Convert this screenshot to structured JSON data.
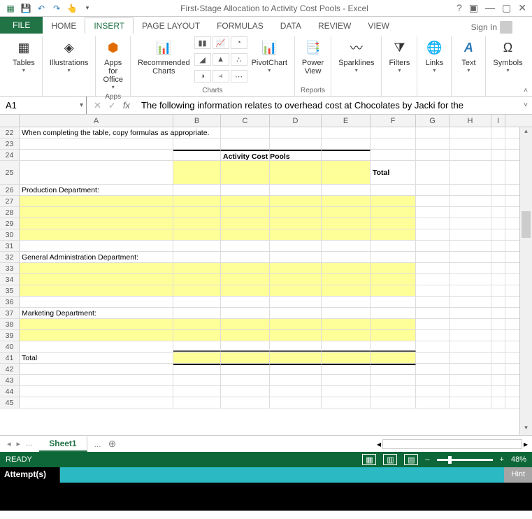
{
  "titlebar": {
    "title": "First-Stage Allocation to Activity Cost Pools - Excel"
  },
  "tabs": {
    "file": "FILE",
    "home": "HOME",
    "insert": "INSERT",
    "page_layout": "PAGE LAYOUT",
    "formulas": "FORMULAS",
    "data": "DATA",
    "review": "REVIEW",
    "view": "VIEW",
    "signin": "Sign In"
  },
  "ribbon": {
    "tables": "Tables",
    "illustrations": "Illustrations",
    "apps_for_office": "Apps for\nOffice",
    "apps": "Apps",
    "recommended_charts": "Recommended\nCharts",
    "charts": "Charts",
    "pivotchart": "PivotChart",
    "power_view": "Power\nView",
    "reports": "Reports",
    "sparklines": "Sparklines",
    "filters": "Filters",
    "links": "Links",
    "text": "Text",
    "symbols": "Symbols"
  },
  "formula_bar": {
    "cell_ref": "A1",
    "formula": "The following information relates to overhead cost at Chocolates by Jacki for the"
  },
  "columns": [
    "A",
    "B",
    "C",
    "D",
    "E",
    "F",
    "G",
    "H",
    "I"
  ],
  "rows": {
    "r22": "When completing the table, copy formulas as appropriate.",
    "r24_header": "Activity Cost Pools",
    "r25_total": "Total",
    "r26": "Production Department:",
    "r32": "General Administration Department:",
    "r37": "Marketing Department:",
    "r41": "Total"
  },
  "sheetbar": {
    "sheet1": "Sheet1",
    "dots1": "...",
    "dots2": "..."
  },
  "statusbar": {
    "ready": "READY",
    "zoom": "48%"
  },
  "bottombar": {
    "attempts": "Attempt(s)",
    "hint": "Hint"
  },
  "chart_data": {
    "type": "table",
    "title": "First-Stage Allocation to Activity Cost Pools",
    "note": "When completing the table, copy formulas as appropriate.",
    "column_group_header": "Activity Cost Pools",
    "columns": [
      "B",
      "C",
      "D",
      "E",
      "F (Total)"
    ],
    "row_sections": [
      {
        "label": "Production Department:",
        "rows": 4
      },
      {
        "label": "General Administration Department:",
        "rows": 3
      },
      {
        "label": "Marketing Department:",
        "rows": 2
      },
      {
        "label": "Total",
        "rows": 1
      }
    ]
  }
}
